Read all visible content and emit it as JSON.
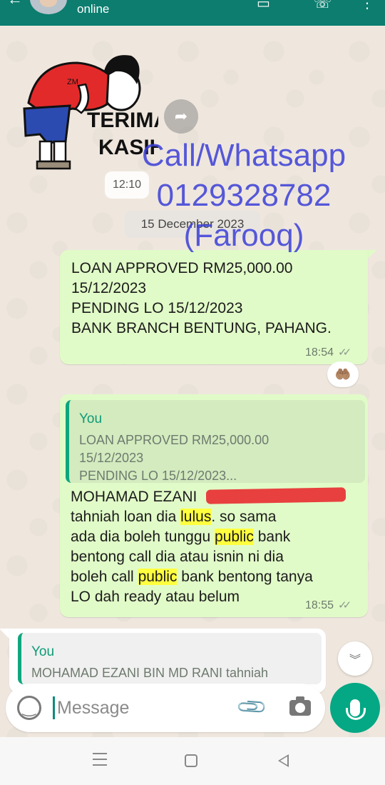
{
  "header": {
    "status": "online"
  },
  "sticker": {
    "text": "TERIMA KASIH",
    "shirt_label": "ZM"
  },
  "timestamps": {
    "sticker_time": "12:10",
    "date_separator": "15 December 2023"
  },
  "watermark": {
    "line1": "Call/Whatsapp",
    "line2": "0129328782",
    "line3": "(Farooq)",
    "color": "#3b3fd8"
  },
  "messages": [
    {
      "direction": "outgoing",
      "lines": [
        "LOAN APPROVED RM25,000.00",
        "15/12/2023",
        "PENDING LO 15/12/2023",
        "BANK BRANCH BENTUNG, PAHANG."
      ],
      "time": "18:54",
      "reaction": "🤲🏽"
    },
    {
      "direction": "outgoing",
      "quote": {
        "author": "You",
        "lines": [
          "LOAN APPROVED RM25,000.00",
          "15/12/2023",
          "PENDING LO 15/12/2023..."
        ]
      },
      "body": {
        "line1": "MOHAMAD EZANI",
        "line2_a": "tahniah loan dia ",
        "line2_hl": "lulus",
        "line2_b": ". so sama",
        "line3_a": "ada dia boleh tunggu ",
        "line3_hl": "public",
        "line3_b": " bank",
        "line4": "bentong call dia atau isnin ni dia",
        "line5_a": "boleh call ",
        "line5_hl": "public",
        "line5_b": " bank bentong tanya",
        "line6": "LO dah ready atau belum"
      },
      "time": "18:55"
    },
    {
      "direction": "incoming",
      "quote": {
        "author": "You",
        "line": "MOHAMAD EZANI BIN MD RANI tahniah"
      }
    }
  ],
  "composer": {
    "placeholder": "Message"
  },
  "colors": {
    "header": "#0c7d6f",
    "outgoing_bubble": "#e1fbc8",
    "accent": "#04a884",
    "highlight": "#ffff3d"
  }
}
